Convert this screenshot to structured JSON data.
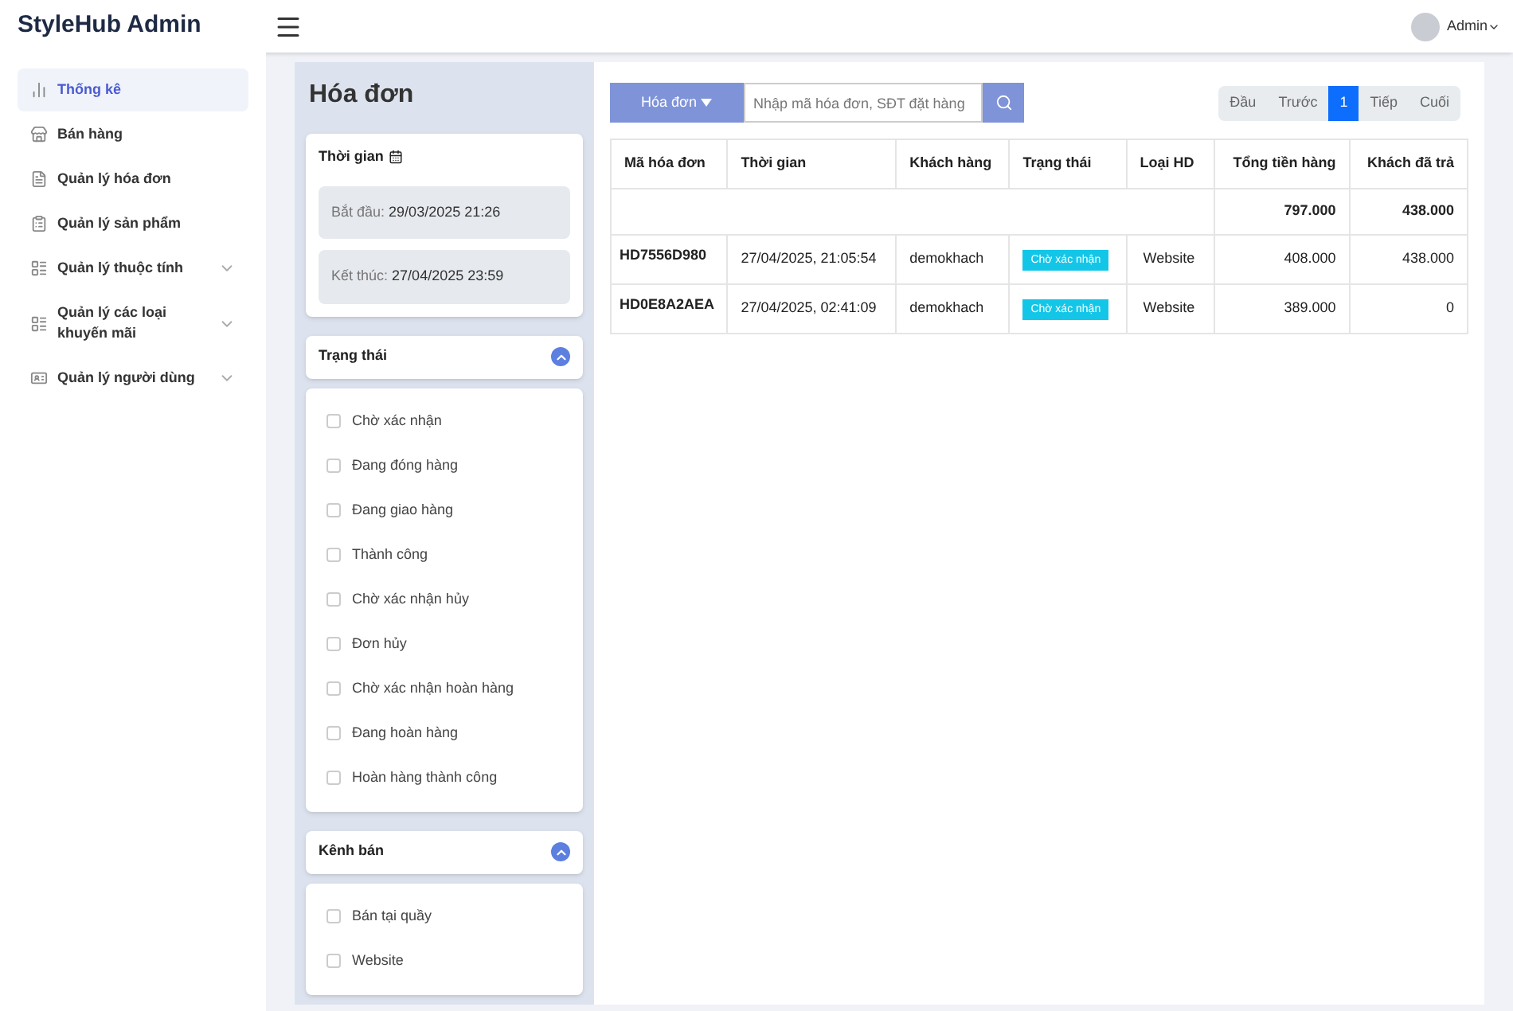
{
  "brand": "StyleHub Admin",
  "user": {
    "name": "Admin"
  },
  "sidebar": {
    "items": [
      {
        "label": "Thống kê",
        "kind": "link",
        "selected": true
      },
      {
        "label": "Bán hàng",
        "kind": "link",
        "selected": false
      },
      {
        "label": "Quản lý hóa đơn",
        "kind": "link",
        "selected": false
      },
      {
        "label": "Quản lý sản phẩm",
        "kind": "link",
        "selected": false
      },
      {
        "label": "Quản lý thuộc tính",
        "kind": "group",
        "selected": false
      },
      {
        "label": "Quản lý các loại khuyến mãi",
        "kind": "group",
        "selected": false
      },
      {
        "label": "Quản lý người dùng",
        "kind": "group",
        "selected": false
      }
    ]
  },
  "page_title": "Hóa đơn",
  "time_filter": {
    "title": "Thời gian",
    "start_label": "Bắt đầu:",
    "start": "29/03/2025 21:26",
    "end_label": "Kết thúc:",
    "end": "27/04/2025 23:59"
  },
  "filters": [
    {
      "title": "Trạng thái",
      "expanded": true,
      "options": [
        {
          "label": "Chờ xác nhận",
          "checked": false
        },
        {
          "label": "Đang đóng hàng",
          "checked": false
        },
        {
          "label": "Đang giao hàng",
          "checked": false
        },
        {
          "label": "Thành công",
          "checked": false
        },
        {
          "label": "Chờ xác nhận hủy",
          "checked": false
        },
        {
          "label": "Đơn hủy",
          "checked": false
        },
        {
          "label": "Chờ xác nhận hoàn hàng",
          "checked": false
        },
        {
          "label": "Đang hoàn hàng",
          "checked": false
        },
        {
          "label": "Hoàn hàng thành công",
          "checked": false
        }
      ]
    },
    {
      "title": "Kênh bán",
      "expanded": true,
      "options": [
        {
          "label": "Bán tại quầy",
          "checked": false
        },
        {
          "label": "Website",
          "checked": false
        }
      ]
    }
  ],
  "search": {
    "dropdown": "Hóa đơn",
    "placeholder": "Nhập mã hóa đơn, SĐT đặt hàng"
  },
  "pagination": [
    {
      "label": "Đầu",
      "selected": false
    },
    {
      "label": "Trước",
      "selected": false
    },
    {
      "label": "1",
      "selected": true
    },
    {
      "label": "Tiếp",
      "selected": false
    },
    {
      "label": "Cuối",
      "selected": false
    }
  ],
  "table": {
    "columns": [
      "Mã hóa đơn",
      "Thời gian",
      "Khách hàng",
      "Trạng thái",
      "Loại HD",
      "Tổng tiền hàng",
      "Khách đã trả"
    ],
    "totals": {
      "total": "797.000",
      "paid": "438.000"
    },
    "rows": [
      {
        "code": "HD7556D980",
        "time": "27/04/2025, 21:05:54",
        "customer": "demokhach",
        "status": "Chờ xác nhận",
        "type": "Website",
        "total": "408.000",
        "paid": "438.000"
      },
      {
        "code": "HD0E8A2AEA",
        "time": "27/04/2025, 02:41:09",
        "customer": "demokhach",
        "status": "Chờ xác nhận",
        "type": "Website",
        "total": "389.000",
        "paid": "0"
      }
    ]
  }
}
